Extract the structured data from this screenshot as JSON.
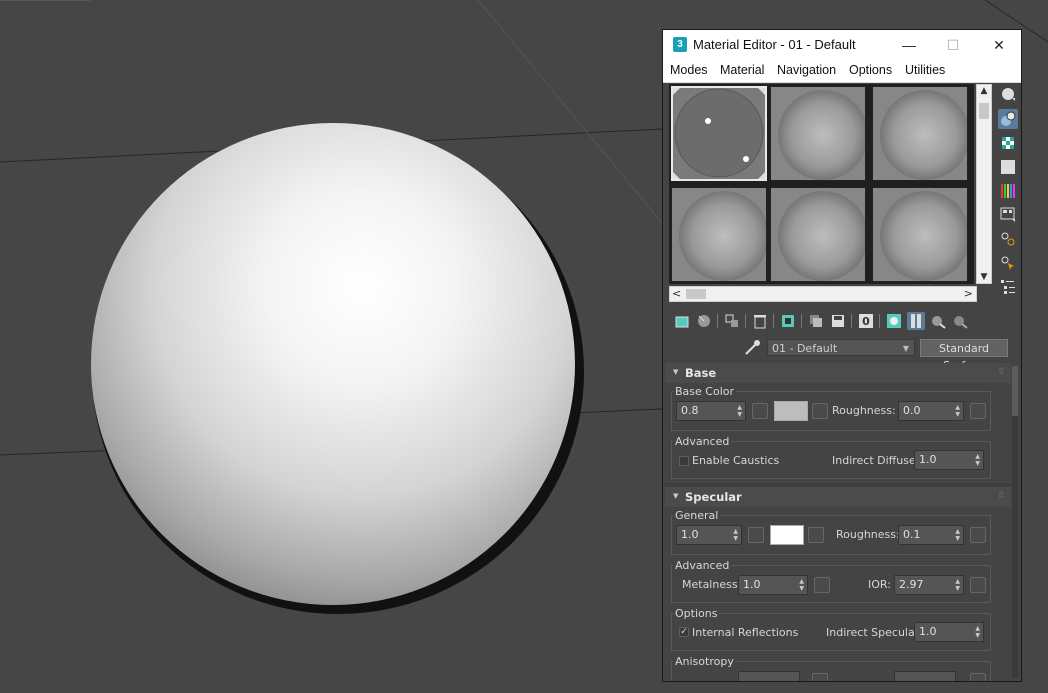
{
  "window": {
    "app_icon_text": "3",
    "title": "Material Editor - 01 - Default",
    "minimize": "—",
    "maximize": "☐",
    "close": "✕"
  },
  "menu": [
    "Modes",
    "Material",
    "Navigation",
    "Options",
    "Utilities"
  ],
  "slots_preview": {
    "active_slot": 1,
    "slot_count": 6
  },
  "material": {
    "name": "01 - Default",
    "type": "Standard Surface"
  },
  "base": {
    "title": "Base",
    "base_color_group": "Base Color",
    "weight": "0.8",
    "color": "#bdbdbd",
    "roughness_label": "Roughness:",
    "roughness": "0.0",
    "advanced_group": "Advanced",
    "enable_caustics_label": "Enable Caustics",
    "enable_caustics": false,
    "indirect_diffuse_label": "Indirect Diffuse:",
    "indirect_diffuse": "1.0"
  },
  "specular": {
    "title": "Specular",
    "general_group": "General",
    "weight": "1.0",
    "color": "#ffffff",
    "roughness_label": "Roughness:",
    "roughness": "0.1",
    "advanced_group": "Advanced",
    "metalness_label": "Metalness:",
    "metalness": "1.0",
    "ior_label": "IOR:",
    "ior": "2.97",
    "options_group": "Options",
    "internal_reflections_label": "Internal Reflections",
    "internal_reflections": true,
    "indirect_specular_label": "Indirect Specular:",
    "indirect_specular": "1.0",
    "anisotropy_group": "Anisotropy"
  },
  "colors": {
    "viewport_bg": "#464646",
    "accent_selected": "#5a7c9a",
    "app_icon": "#1b9fb8"
  }
}
